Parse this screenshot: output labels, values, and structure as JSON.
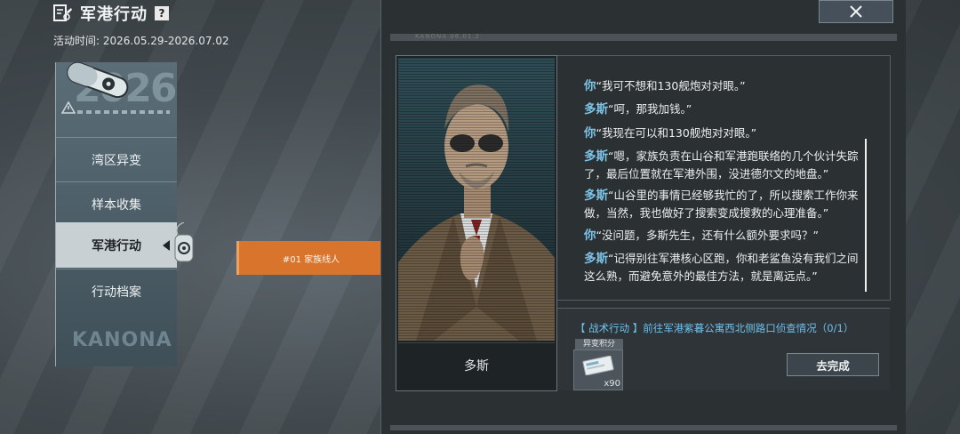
{
  "header": {
    "title": "军港行动",
    "help_glyph": "?",
    "date_label": "活动时间: 2026.05.29-2026.07.02"
  },
  "menu": {
    "logo_numerals": "2026",
    "watermark": "KANONA",
    "items": [
      {
        "label": "湾区异变",
        "active": false
      },
      {
        "label": "样本收集",
        "active": false
      },
      {
        "label": "军港行动",
        "active": true
      },
      {
        "label": "行动档案",
        "active": false
      }
    ]
  },
  "quest_tab": {
    "label": "#01 家族线人"
  },
  "panel": {
    "top_caption": "KANONA 06.01.2",
    "close_icon": "close-icon",
    "character_name": "多斯",
    "dialogue": [
      {
        "speaker": "你",
        "text": "“我可不想和130舰炮对对眼。”"
      },
      {
        "speaker": "多斯",
        "text": "“呵，那我加钱。”"
      },
      {
        "speaker": "你",
        "text": "“我现在可以和130舰炮对对眼。”"
      },
      {
        "speaker": "多斯",
        "text": "“嗯，家族负责在山谷和军港跑联络的几个伙计失踪了，最后位置就在军港外围，没进德尔文的地盘。”"
      },
      {
        "speaker": "多斯",
        "text": "“山谷里的事情已经够我忙的了，所以搜索工作你来做，当然，我也做好了搜索变成搜救的心理准备。”"
      },
      {
        "speaker": "你",
        "text": "“没问题，多斯先生，还有什么额外要求吗？”"
      },
      {
        "speaker": "多斯",
        "text": "“记得别往军港核心区跑，你和老鲨鱼没有我们之间这么熟，而避免意外的最佳方法，就是离远点。”"
      }
    ],
    "task": {
      "text": "【 战术行动 】前往军港紫暮公寓西北侧路口侦查情况（0/1）",
      "reward_label": "异变积分",
      "reward_qty": "x90",
      "go_button": "去完成"
    }
  },
  "colors": {
    "accent_blue": "#7cc3e6",
    "orange": "#d9742c",
    "panel_bg": "#2b3033"
  }
}
